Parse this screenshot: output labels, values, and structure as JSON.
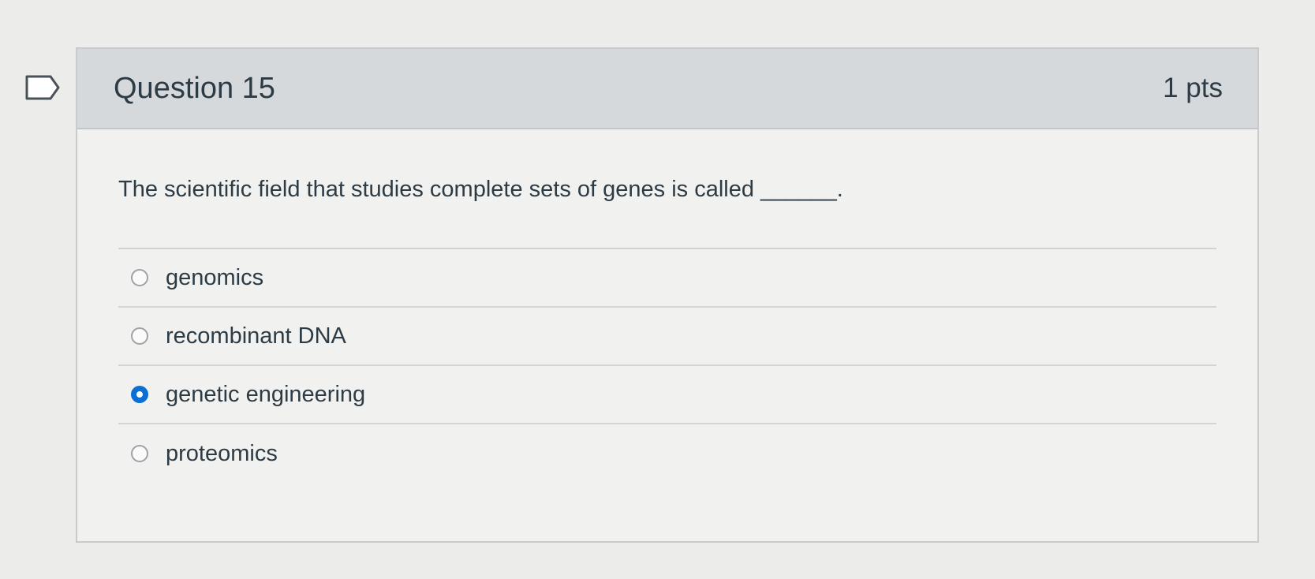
{
  "question": {
    "title": "Question 15",
    "points": "1 pts",
    "prompt": "The scientific field that studies complete sets of genes is called ______.",
    "flag_icon": "bookmark-flag-icon"
  },
  "answers": [
    {
      "label": "genomics",
      "selected": false
    },
    {
      "label": "recombinant DNA",
      "selected": false
    },
    {
      "label": "genetic engineering",
      "selected": true
    },
    {
      "label": "proteomics",
      "selected": false
    }
  ],
  "colors": {
    "header_bg": "#d6d9dc",
    "selected_radio": "#0b6fd3",
    "text": "#2d3b45"
  }
}
